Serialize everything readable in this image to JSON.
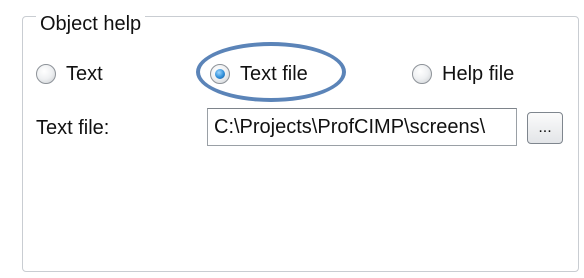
{
  "object_help": {
    "title": "Object help",
    "radios": [
      {
        "label": "Text",
        "checked": false
      },
      {
        "label": "Text file",
        "checked": true
      },
      {
        "label": "Help file",
        "checked": false
      }
    ],
    "text_file_label": "Text file:",
    "text_file_value": "C:\\Projects\\ProfCIMP\\screens\\",
    "browse_label": "...",
    "highlight_color": "#5b84b8"
  }
}
